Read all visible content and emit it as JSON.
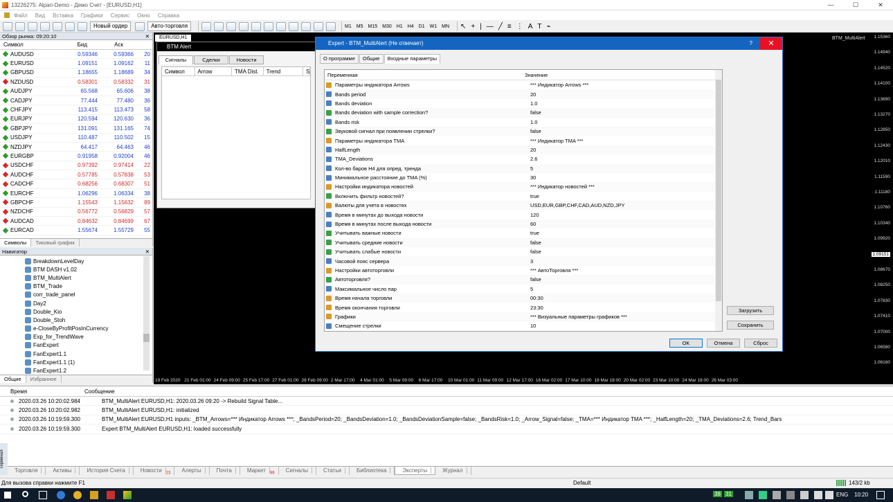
{
  "window": {
    "title": "13226275: Alpari-Demo - Демо Счет - [EURUSD,H1]"
  },
  "menu": [
    "Файл",
    "Вид",
    "Вставка",
    "Графики",
    "Сервис",
    "Окно",
    "Справка"
  ],
  "toolbar": {
    "new_order": "Новый ордер",
    "autotrading": "Авто-торговля",
    "timeframes": [
      "M1",
      "M5",
      "M15",
      "M30",
      "H1",
      "H4",
      "D1",
      "W1",
      "MN"
    ]
  },
  "market_watch": {
    "title": "Обзор рынка: 09:20:10",
    "cols": [
      "Символ",
      "Бид",
      "Аск",
      ""
    ],
    "rows": [
      {
        "s": "AUDUSD",
        "b": "0.59346",
        "a": "0.59366",
        "sp": "20",
        "dir": "up"
      },
      {
        "s": "EURUSD",
        "b": "1.09151",
        "a": "1.09162",
        "sp": "11",
        "dir": "up"
      },
      {
        "s": "GBPUSD",
        "b": "1.18655",
        "a": "1.18689",
        "sp": "34",
        "dir": "up"
      },
      {
        "s": "NZDUSD",
        "b": "0.58301",
        "a": "0.58332",
        "sp": "31",
        "dir": "down"
      },
      {
        "s": "AUDJPY",
        "b": "65.568",
        "a": "65.606",
        "sp": "38",
        "dir": "up"
      },
      {
        "s": "CADJPY",
        "b": "77.444",
        "a": "77.480",
        "sp": "36",
        "dir": "up"
      },
      {
        "s": "CHFJPY",
        "b": "113.415",
        "a": "113.473",
        "sp": "58",
        "dir": "up"
      },
      {
        "s": "EURJPY",
        "b": "120.594",
        "a": "120.630",
        "sp": "36",
        "dir": "up"
      },
      {
        "s": "GBPJPY",
        "b": "131.091",
        "a": "131.165",
        "sp": "74",
        "dir": "up"
      },
      {
        "s": "USDJPY",
        "b": "110.487",
        "a": "110.502",
        "sp": "15",
        "dir": "up"
      },
      {
        "s": "NZDJPY",
        "b": "64.417",
        "a": "64.463",
        "sp": "46",
        "dir": "up"
      },
      {
        "s": "EURGBP",
        "b": "0.91958",
        "a": "0.92004",
        "sp": "46",
        "dir": "up"
      },
      {
        "s": "USDCHF",
        "b": "0.97392",
        "a": "0.97414",
        "sp": "22",
        "dir": "down"
      },
      {
        "s": "AUDCHF",
        "b": "0.57785",
        "a": "0.57838",
        "sp": "53",
        "dir": "down"
      },
      {
        "s": "CADCHF",
        "b": "0.68256",
        "a": "0.68307",
        "sp": "51",
        "dir": "down"
      },
      {
        "s": "EURCHF",
        "b": "1.06296",
        "a": "1.06334",
        "sp": "38",
        "dir": "up"
      },
      {
        "s": "GBPCHF",
        "b": "1.15543",
        "a": "1.15632",
        "sp": "89",
        "dir": "down"
      },
      {
        "s": "NZDCHF",
        "b": "0.56772",
        "a": "0.56829",
        "sp": "57",
        "dir": "down"
      },
      {
        "s": "AUDCAD",
        "b": "0.84632",
        "a": "0.84699",
        "sp": "67",
        "dir": "down"
      },
      {
        "s": "EURCAD",
        "b": "1.55674",
        "a": "1.55729",
        "sp": "55",
        "dir": "up"
      }
    ],
    "tabs": [
      "Символы",
      "Тиковый график"
    ]
  },
  "navigator": {
    "title": "Навигатор",
    "items": [
      "BreakdownLevelDay",
      "BTM DASH v1.02",
      "BTM_MultiAlert",
      "BTM_Trade",
      "corr_trade_panel",
      "Day2",
      "Double_Kio",
      "Double_Stoh",
      "e-CloseByProfitPosInCurrency",
      "Exp_for_TrendWave",
      "FanExpert",
      "FanExpert1.1",
      "FanExpert1.1 (1)",
      "FanExpert1.2"
    ],
    "tabs": [
      "Общие",
      "Избранное"
    ]
  },
  "chart": {
    "symbol_label": "EURUSD,H1",
    "indicator_label": "BTM_MultiAlert",
    "prices": [
      "1.15360",
      "1.14940",
      "1.14520",
      "1.14100",
      "1.13690",
      "1.13270",
      "1.12850",
      "1.12430",
      "1.12010",
      "1.11590",
      "1.11180",
      "1.10760",
      "1.10340",
      "1.09920",
      "1.09151",
      "1.08670",
      "1.08250",
      "1.07830",
      "1.07410",
      "1.07000",
      "1.06580",
      "1.06160"
    ],
    "current_price": "1.09151",
    "times": [
      "19 Feb 2020",
      "21 Feb 01:00",
      "24 Feb 09:00",
      "25 Feb 17:00",
      "27 Feb 01:00",
      "28 Feb 09:00",
      "2 Mar 17:00",
      "4 Mar 01:00",
      "5 Mar 09:00",
      "6 Mar 17:00",
      "10 Mar 01:00",
      "11 Mar 09:00",
      "12 Mar 17:00",
      "16 Mar 02:00",
      "17 Mar 10:00",
      "18 Mar 18:00",
      "20 Mar 02:00",
      "23 Mar 10:00",
      "24 Mar 18:00",
      "26 Mar 03:00"
    ]
  },
  "btm_alert": {
    "title": "BTM Alert",
    "tabs": [
      "Сигналы",
      "Сделки",
      "Новости"
    ],
    "cols": [
      "Символ",
      "Arrow",
      "TMA Dist.",
      "Trend",
      "Spr"
    ]
  },
  "dialog": {
    "title": "Expert - BTM_MultiAlert (Не отвечает)",
    "help": "?",
    "close": "✕",
    "tabs": [
      "О программе",
      "Общие",
      "Входные параметры"
    ],
    "cols": [
      "Переменная",
      "Значение"
    ],
    "params": [
      {
        "n": "Параметры индикатора Arrows",
        "v": "*** Индикатор Arrows ***",
        "t": "abc"
      },
      {
        "n": "Bands period",
        "v": "20",
        "t": "123"
      },
      {
        "n": "Bands deviation",
        "v": "1.0",
        "t": "123"
      },
      {
        "n": "Bands deviation with sample correction?",
        "v": "false",
        "t": "bool"
      },
      {
        "n": "Bands risk",
        "v": "1.0",
        "t": "123"
      },
      {
        "n": "Звуковой сигнал при появлении стрелки?",
        "v": "false",
        "t": "bool"
      },
      {
        "n": "Параметры индикатора TMA",
        "v": "*** Индикатор TMA ***",
        "t": "abc"
      },
      {
        "n": "HalfLength",
        "v": "20",
        "t": "123"
      },
      {
        "n": "TMA_Deviations",
        "v": "2.6",
        "t": "123"
      },
      {
        "n": "Кол-во баров H4 для опред. тренда",
        "v": "5",
        "t": "123"
      },
      {
        "n": "Минимальное расстояние до TMA (%)",
        "v": "30",
        "t": "123"
      },
      {
        "n": "Настройки индикатора новостей",
        "v": "*** Индикатор новостей ***",
        "t": "abc"
      },
      {
        "n": "Включить фильтр новостей?",
        "v": "true",
        "t": "bool"
      },
      {
        "n": "Валюты для учета в новостях",
        "v": "USD,EUR,GBP,CHF,CAD,AUD,NZD,JPY",
        "t": "abc"
      },
      {
        "n": "Время в минутах до выхода новости",
        "v": "120",
        "t": "123"
      },
      {
        "n": "Время в минутах после выхода новости",
        "v": "60",
        "t": "123"
      },
      {
        "n": "Учитывать важные новости",
        "v": "true",
        "t": "bool"
      },
      {
        "n": "Учитывать средние новости",
        "v": "false",
        "t": "bool"
      },
      {
        "n": "Учитывать слабые новости",
        "v": "false",
        "t": "bool"
      },
      {
        "n": "Часовой пояс сервера",
        "v": "3",
        "t": "123"
      },
      {
        "n": "Настройки автоторговли",
        "v": "*** АвтоТорговля ***",
        "t": "abc"
      },
      {
        "n": "Автоторговля?",
        "v": "false",
        "t": "bool"
      },
      {
        "n": "Максимальное число пар",
        "v": "5",
        "t": "123"
      },
      {
        "n": "Время начала торговли",
        "v": "00:30",
        "t": "abc"
      },
      {
        "n": "Время окончания торговли",
        "v": "23:30",
        "t": "abc"
      },
      {
        "n": "Графики",
        "v": "*** Визуальные параметры графиков ***",
        "t": "abc"
      },
      {
        "n": "Смещение стрелки",
        "v": "10",
        "t": "123"
      }
    ],
    "load": "Загрузить",
    "save": "Сохранить",
    "ok": "OK",
    "cancel": "Отмена",
    "reset": "Сброс"
  },
  "log": {
    "cols": [
      "Время",
      "Сообщение"
    ],
    "rows": [
      {
        "t": "2020.03.26 10:20:02.984",
        "m": "BTM_MultiAlert EURUSD,H1: 2020.03.26 09:20 -> Rebuild Signal Table..."
      },
      {
        "t": "2020.03.26 10:20:02.982",
        "m": "BTM_MultiAlert EURUSD,H1: initialized"
      },
      {
        "t": "2020.03.26 10:19:59.300",
        "m": "BTM_MultiAlert EURUSD,H1 inputs: _BTM_Arrows=*** Индикатор Arrows ***; _BandsPeriod=20; _BandsDeviation=1.0; _BandsDeviationSample=false; _BandsRisk=1.0; _Arrow_Signal=false; _TMA=*** Индикатор TMA ***; _HalfLength=20; _TMA_Deviations=2.6; Trend_Bars"
      },
      {
        "t": "2020.03.26 10:19:59.300",
        "m": "Expert BTM_MultiAlert EURUSD,H1: loaded successfully"
      }
    ]
  },
  "terminal_label": "Терминал",
  "bottom_tabs": [
    {
      "l": "Торговля"
    },
    {
      "l": "Активы"
    },
    {
      "l": "История Счета"
    },
    {
      "l": "Новости",
      "b": "23"
    },
    {
      "l": "Алерты"
    },
    {
      "l": "Почта"
    },
    {
      "l": "Маркет",
      "b": "96"
    },
    {
      "l": "Сигналы"
    },
    {
      "l": "Статьи"
    },
    {
      "l": "Библиотека"
    },
    {
      "l": "Эксперты",
      "active": true
    },
    {
      "l": "Журнал"
    }
  ],
  "status": {
    "help": "Для вызова справки нажмите F1",
    "profile": "Default",
    "traffic": "143/2 kb"
  },
  "taskbar": {
    "lang": "ENG",
    "time": "10:20",
    "badge1": "38",
    "badge2": "31"
  }
}
